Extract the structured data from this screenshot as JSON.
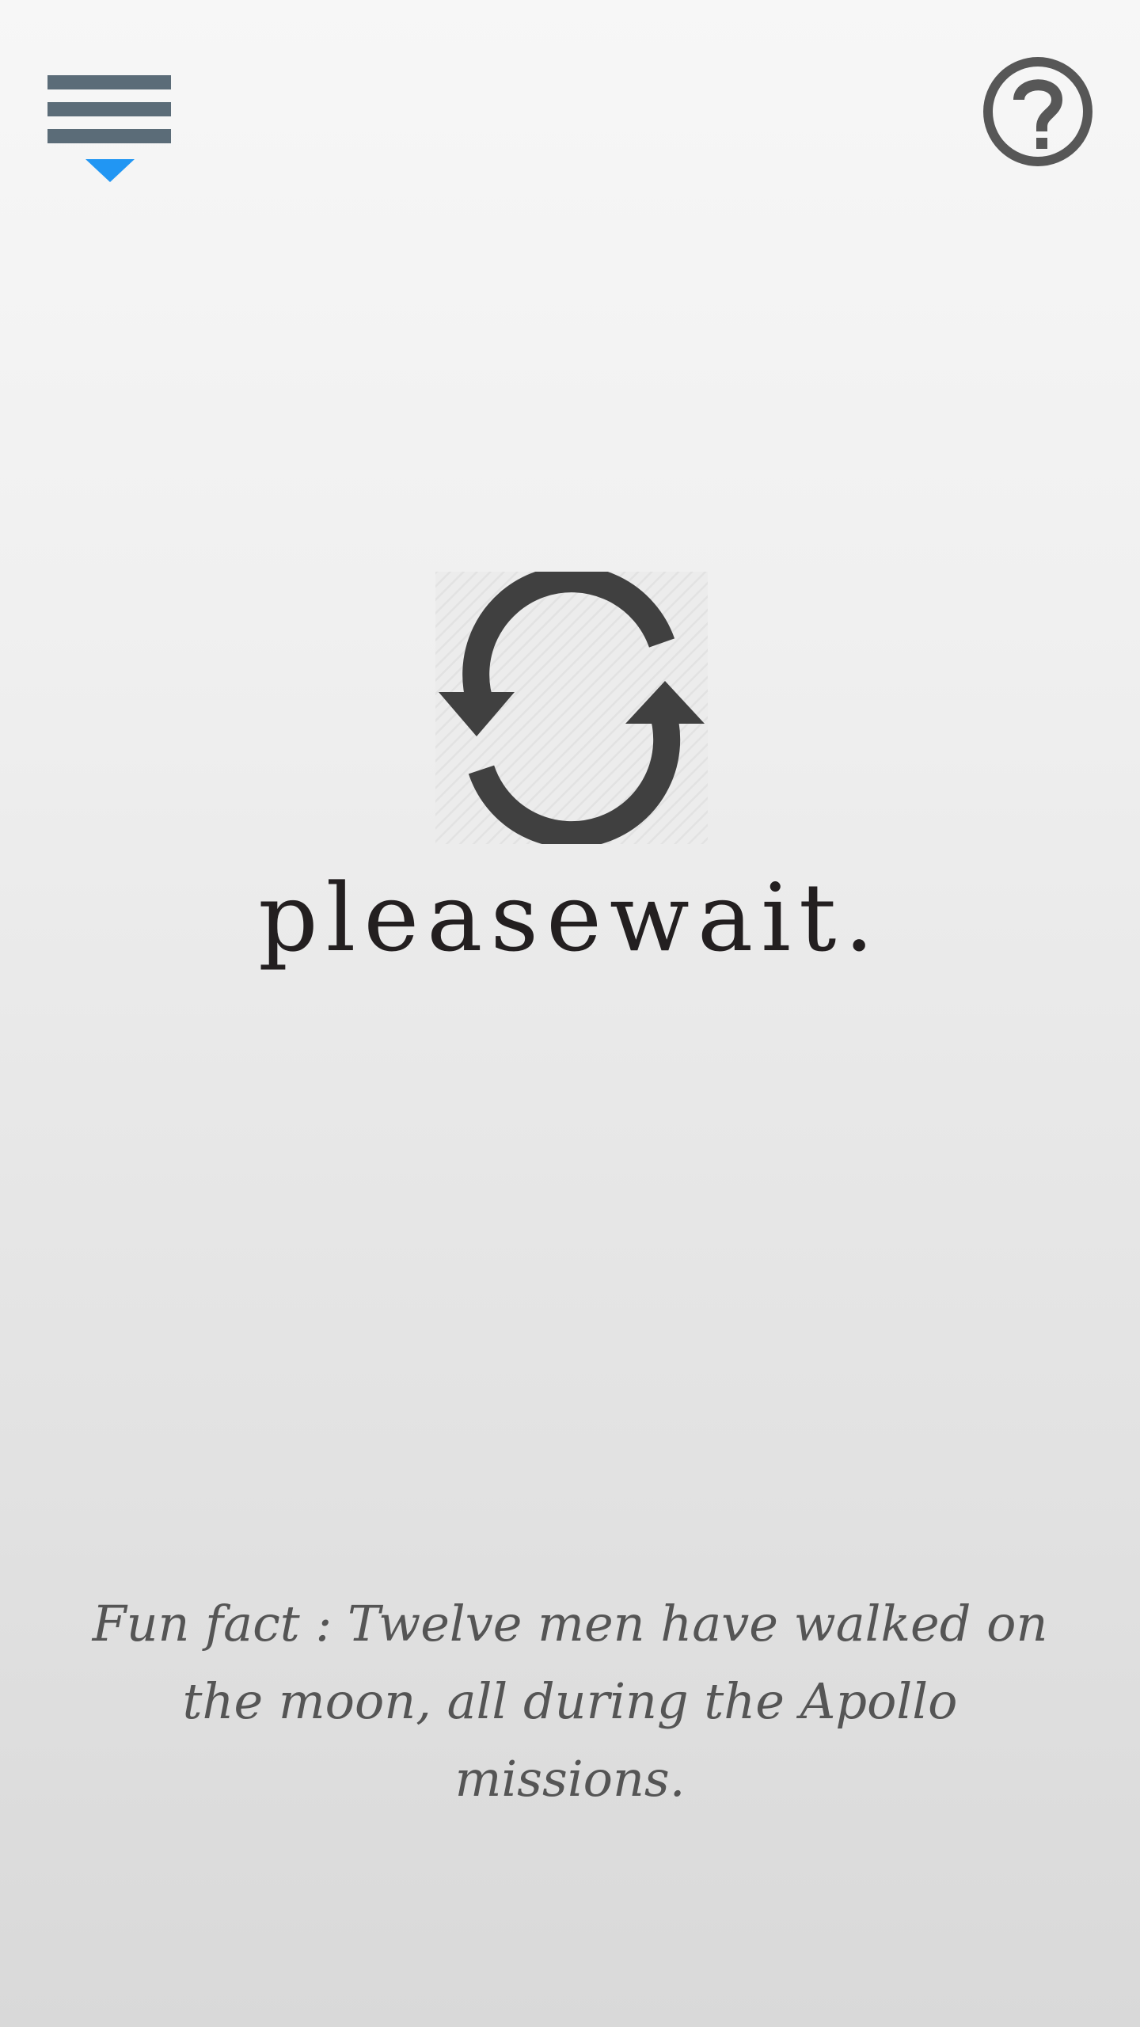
{
  "header": {
    "menu_icon": "menu-dropdown-icon",
    "help_icon": "help-circle-icon"
  },
  "loader": {
    "icon": "refresh-icon",
    "brand_text": "pleasewait."
  },
  "footer": {
    "fun_fact": "Fun fact : Twelve men have walked on the moon, all during the Apollo missions."
  },
  "colors": {
    "menu_bars": "#5b6c78",
    "menu_caret": "#2196f3",
    "help_icon": "#575757",
    "loader_icon": "#404040",
    "brand_text": "#231f20",
    "fun_fact_text": "#555555"
  }
}
